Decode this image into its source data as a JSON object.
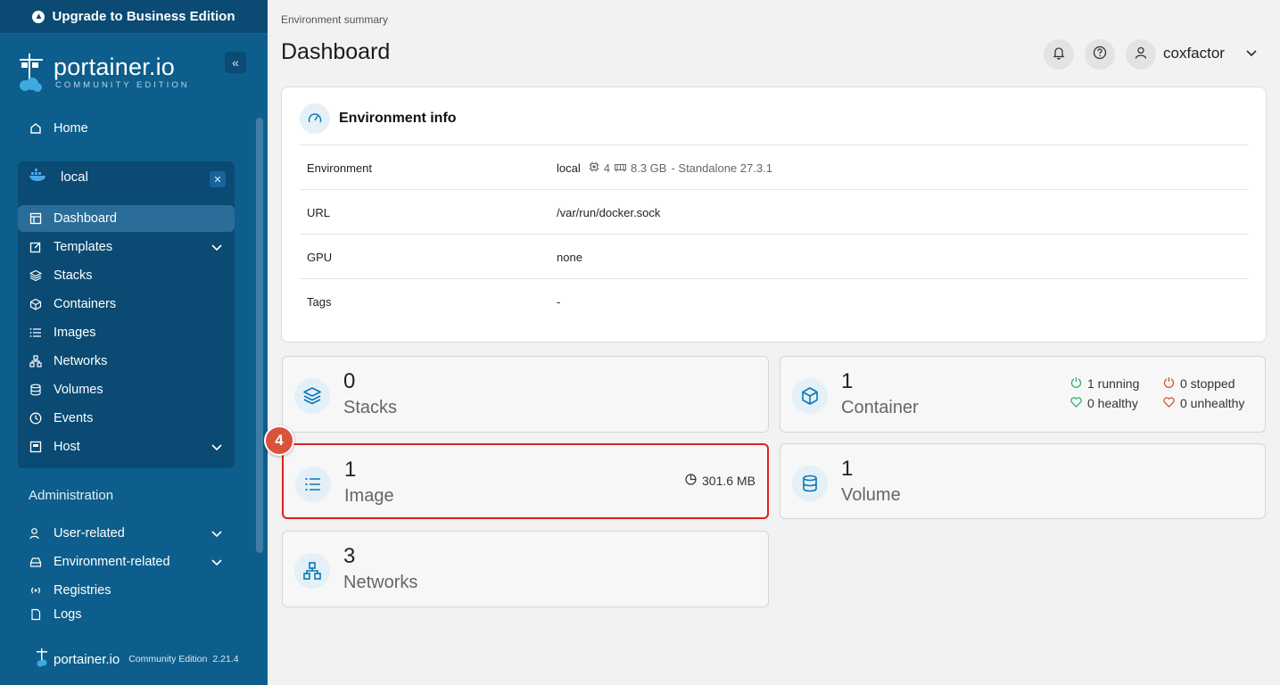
{
  "sidebar": {
    "upgrade_label": "Upgrade to Business Edition",
    "brand": "portainer.io",
    "brand_sub": "COMMUNITY EDITION",
    "home_label": "Home",
    "environment": {
      "name": "local",
      "items": [
        {
          "label": "Dashboard",
          "icon": "dashboard-icon"
        },
        {
          "label": "Templates",
          "icon": "templates-icon"
        },
        {
          "label": "Stacks",
          "icon": "stacks-icon"
        },
        {
          "label": "Containers",
          "icon": "container-icon"
        },
        {
          "label": "Images",
          "icon": "images-icon"
        },
        {
          "label": "Networks",
          "icon": "networks-icon"
        },
        {
          "label": "Volumes",
          "icon": "volumes-icon"
        },
        {
          "label": "Events",
          "icon": "clock-icon"
        },
        {
          "label": "Host",
          "icon": "host-icon"
        }
      ]
    },
    "admin_title": "Administration",
    "admin_items": [
      {
        "label": "User-related",
        "icon": "user-icon"
      },
      {
        "label": "Environment-related",
        "icon": "drive-icon"
      },
      {
        "label": "Registries",
        "icon": "radio-icon"
      },
      {
        "label": "Logs",
        "icon": "file-icon"
      }
    ],
    "footer_brand": "portainer.io",
    "footer_edition": "Community Edition",
    "footer_version": "2.21.4"
  },
  "header": {
    "breadcrumb": "Environment summary",
    "title": "Dashboard",
    "username": "coxfactor"
  },
  "env_info": {
    "title": "Environment info",
    "rows": [
      {
        "key": "Environment",
        "value": "local",
        "cpu": "4",
        "memory": "8.3 GB",
        "mode": "- Standalone 27.3.1"
      },
      {
        "key": "URL",
        "value": "/var/run/docker.sock"
      },
      {
        "key": "GPU",
        "value": "none"
      },
      {
        "key": "Tags",
        "value": "-"
      }
    ]
  },
  "stats": {
    "stacks": {
      "count": "0",
      "label": "Stacks"
    },
    "containers": {
      "count": "1",
      "label": "Container",
      "running": "1 running",
      "stopped": "0 stopped",
      "healthy": "0 healthy",
      "unhealthy": "0 unhealthy"
    },
    "images": {
      "count": "1",
      "label": "Image",
      "size": "301.6 MB"
    },
    "volumes": {
      "count": "1",
      "label": "Volume"
    },
    "networks": {
      "count": "3",
      "label": "Networks"
    }
  },
  "step_badge": "4",
  "colors": {
    "sidebar": "#0d5e8c",
    "accent": "#0b78b4",
    "highlight": "#e02020",
    "running": "#2fb36b",
    "stopped": "#d9533b"
  }
}
